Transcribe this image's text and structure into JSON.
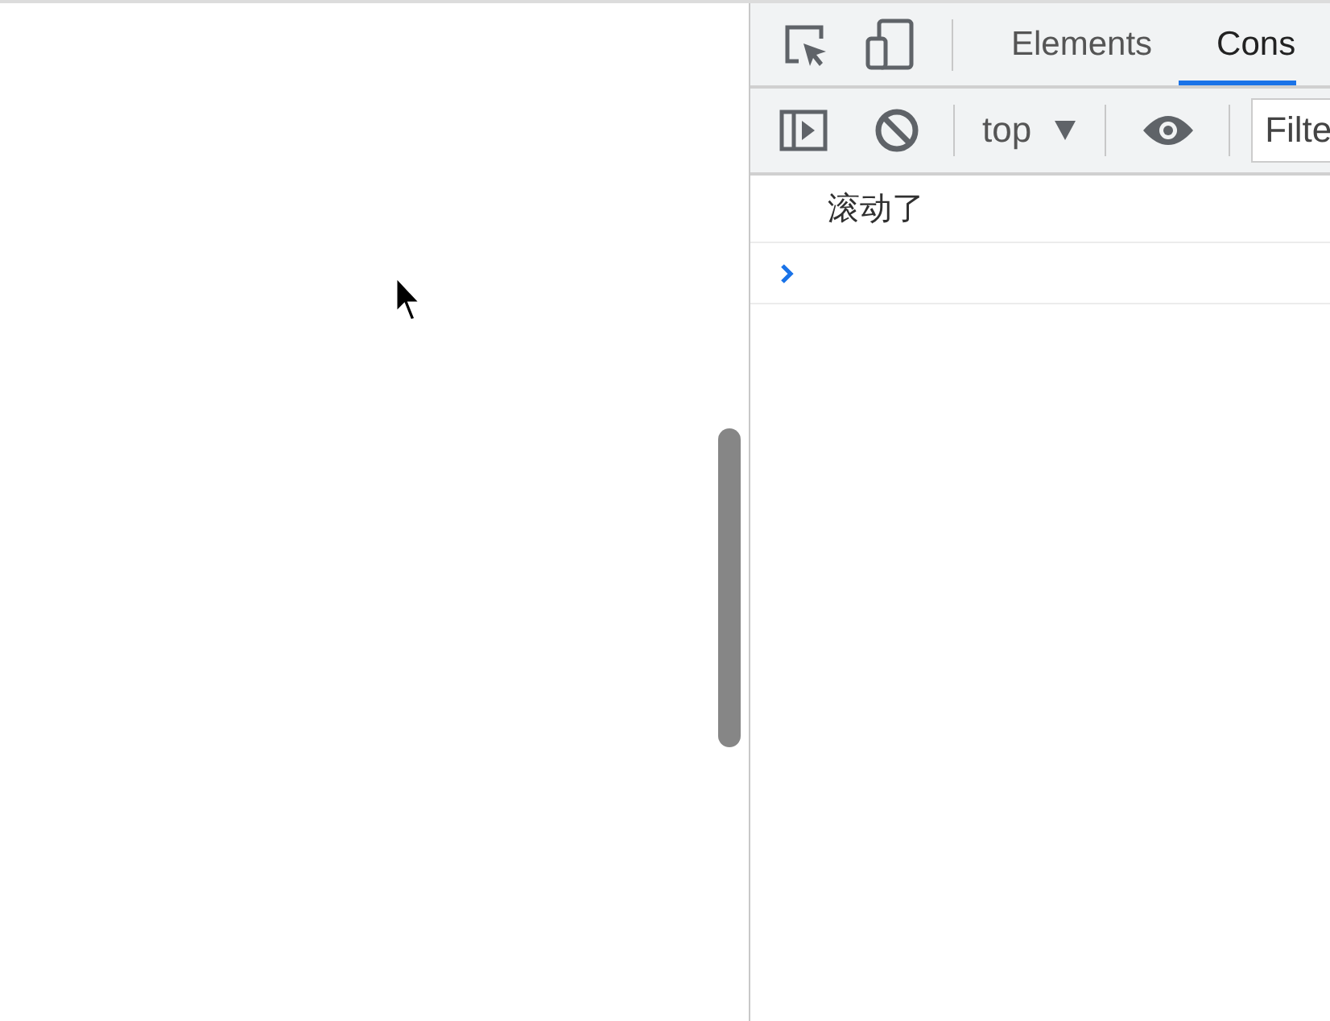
{
  "devtools": {
    "tabs": [
      {
        "label": "Elements",
        "selected": false
      },
      {
        "label": "Cons",
        "selected": true
      }
    ],
    "toolbar": {
      "context": "top",
      "filter": {
        "placeholder": "Filte"
      }
    },
    "console": {
      "messages": [
        {
          "text": "滚动了"
        }
      ]
    }
  }
}
